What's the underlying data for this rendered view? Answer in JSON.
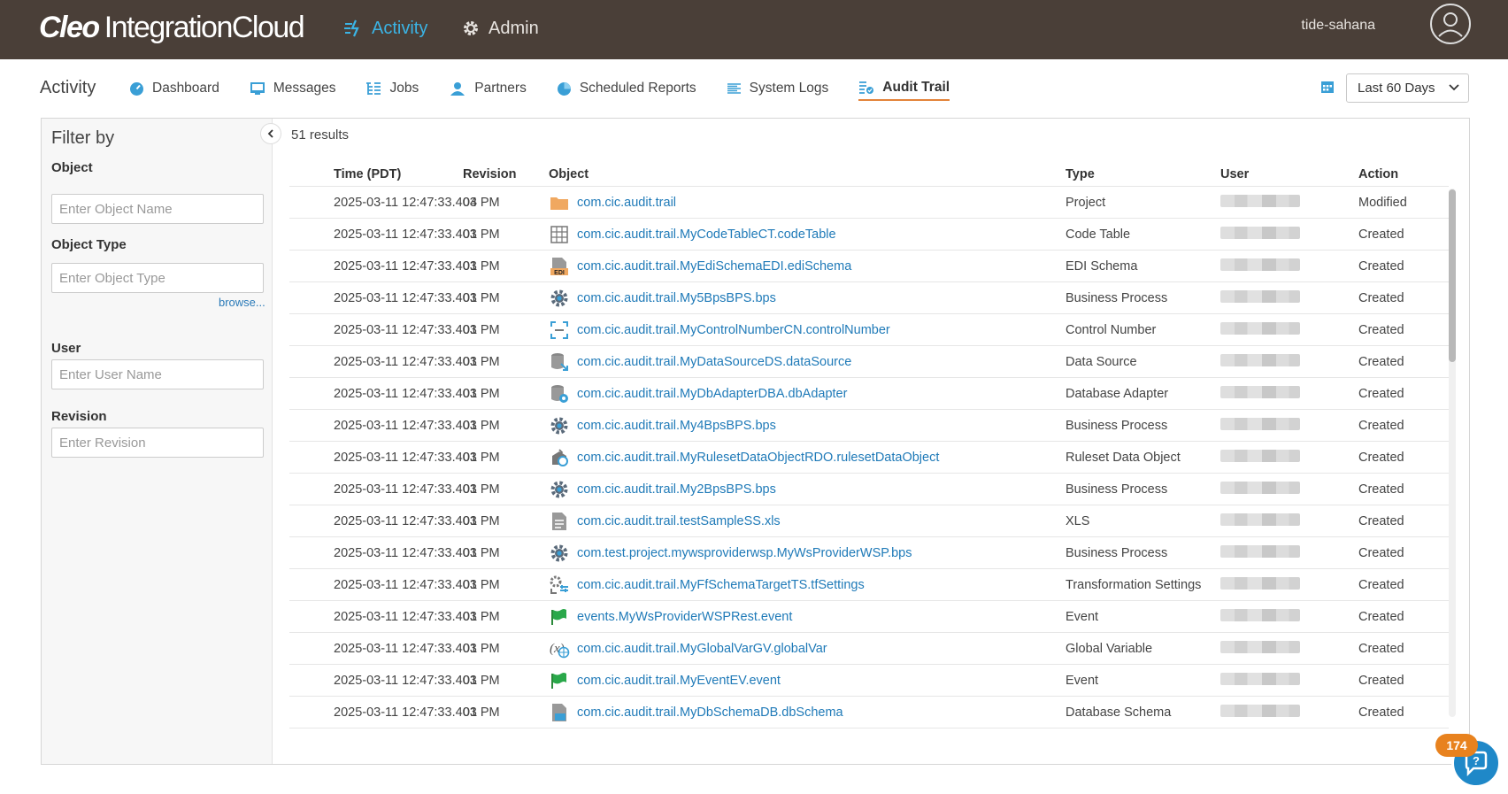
{
  "header": {
    "logo_brand": "Cleo",
    "logo_product": "IntegrationCloud",
    "nav_activity": "Activity",
    "nav_admin": "Admin",
    "username": "tide-sahana"
  },
  "subnav": {
    "page_label": "Activity",
    "items": [
      {
        "label": "Dashboard",
        "icon": "dashboard-icon"
      },
      {
        "label": "Messages",
        "icon": "messages-icon"
      },
      {
        "label": "Jobs",
        "icon": "jobs-icon"
      },
      {
        "label": "Partners",
        "icon": "partners-icon"
      },
      {
        "label": "Scheduled Reports",
        "icon": "pie-chart-icon"
      },
      {
        "label": "System Logs",
        "icon": "list-icon"
      },
      {
        "label": "Audit Trail",
        "icon": "audit-trail-icon",
        "active": true
      }
    ],
    "date_range": "Last 60 Days"
  },
  "filters": {
    "title": "Filter by",
    "object_label": "Object",
    "object_placeholder": "Enter Object Name",
    "object_type_label": "Object Type",
    "object_type_placeholder": "Enter Object Type",
    "browse": "browse...",
    "user_label": "User",
    "user_placeholder": "Enter User Name",
    "revision_label": "Revision",
    "revision_placeholder": "Enter Revision"
  },
  "results": {
    "count_text": "51 results",
    "columns": {
      "time": "Time (PDT)",
      "revision": "Revision",
      "object": "Object",
      "type": "Type",
      "user": "User",
      "action": "Action"
    },
    "rows": [
      {
        "time": "2025-03-11 12:47:33.403 PM",
        "revision": "04",
        "icon": "folder-icon",
        "object": "com.cic.audit.trail",
        "type": "Project",
        "action": "Modified"
      },
      {
        "time": "2025-03-11 12:47:33.403 PM",
        "revision": "01",
        "icon": "code-table-icon",
        "object": "com.cic.audit.trail.MyCodeTableCT.codeTable",
        "type": "Code Table",
        "action": "Created"
      },
      {
        "time": "2025-03-11 12:47:33.403 PM",
        "revision": "01",
        "icon": "edi-schema-icon",
        "object": "com.cic.audit.trail.MyEdiSchemaEDI.ediSchema",
        "type": "EDI Schema",
        "action": "Created"
      },
      {
        "time": "2025-03-11 12:47:33.403 PM",
        "revision": "01",
        "icon": "gear-icon",
        "object": "com.cic.audit.trail.My5BpsBPS.bps",
        "type": "Business Process",
        "action": "Created"
      },
      {
        "time": "2025-03-11 12:47:33.403 PM",
        "revision": "01",
        "icon": "control-number-icon",
        "object": "com.cic.audit.trail.MyControlNumberCN.controlNumber",
        "type": "Control Number",
        "action": "Created"
      },
      {
        "time": "2025-03-11 12:47:33.403 PM",
        "revision": "01",
        "icon": "data-source-icon",
        "object": "com.cic.audit.trail.MyDataSourceDS.dataSource",
        "type": "Data Source",
        "action": "Created"
      },
      {
        "time": "2025-03-11 12:47:33.403 PM",
        "revision": "01",
        "icon": "database-adapter-icon",
        "object": "com.cic.audit.trail.MyDbAdapterDBA.dbAdapter",
        "type": "Database Adapter",
        "action": "Created"
      },
      {
        "time": "2025-03-11 12:47:33.403 PM",
        "revision": "01",
        "icon": "gear-icon",
        "object": "com.cic.audit.trail.My4BpsBPS.bps",
        "type": "Business Process",
        "action": "Created"
      },
      {
        "time": "2025-03-11 12:47:33.403 PM",
        "revision": "01",
        "icon": "ruleset-icon",
        "object": "com.cic.audit.trail.MyRulesetDataObjectRDO.rulesetDataObject",
        "type": "Ruleset Data Object",
        "action": "Created"
      },
      {
        "time": "2025-03-11 12:47:33.403 PM",
        "revision": "01",
        "icon": "gear-icon",
        "object": "com.cic.audit.trail.My2BpsBPS.bps",
        "type": "Business Process",
        "action": "Created"
      },
      {
        "time": "2025-03-11 12:47:33.403 PM",
        "revision": "01",
        "icon": "document-icon",
        "object": "com.cic.audit.trail.testSampleSS.xls",
        "type": "XLS",
        "action": "Created"
      },
      {
        "time": "2025-03-11 12:47:33.403 PM",
        "revision": "01",
        "icon": "gear-icon",
        "object": "com.test.project.mywsproviderwsp.MyWsProviderWSP.bps",
        "type": "Business Process",
        "action": "Created"
      },
      {
        "time": "2025-03-11 12:47:33.403 PM",
        "revision": "01",
        "icon": "transformation-icon",
        "object": "com.cic.audit.trail.MyFfSchemaTargetTS.tfSettings",
        "type": "Transformation Settings",
        "action": "Created"
      },
      {
        "time": "2025-03-11 12:47:33.403 PM",
        "revision": "01",
        "icon": "flag-icon",
        "object": "events.MyWsProviderWSPRest.event",
        "type": "Event",
        "action": "Created"
      },
      {
        "time": "2025-03-11 12:47:33.403 PM",
        "revision": "01",
        "icon": "global-variable-icon",
        "object": "com.cic.audit.trail.MyGlobalVarGV.globalVar",
        "type": "Global Variable",
        "action": "Created"
      },
      {
        "time": "2025-03-11 12:47:33.403 PM",
        "revision": "01",
        "icon": "flag-icon",
        "object": "com.cic.audit.trail.MyEventEV.event",
        "type": "Event",
        "action": "Created"
      },
      {
        "time": "2025-03-11 12:47:33.403 PM",
        "revision": "01",
        "icon": "db-schema-icon",
        "object": "com.cic.audit.trail.MyDbSchemaDB.dbSchema",
        "type": "Database Schema",
        "action": "Created"
      }
    ]
  },
  "help": {
    "badge_count": "174"
  },
  "colors": {
    "header_bg": "#4a3f38",
    "accent_blue": "#3bb4e5",
    "link_blue": "#1f7ab8",
    "active_underline": "#e3833a",
    "badge_orange": "#e8821e"
  }
}
